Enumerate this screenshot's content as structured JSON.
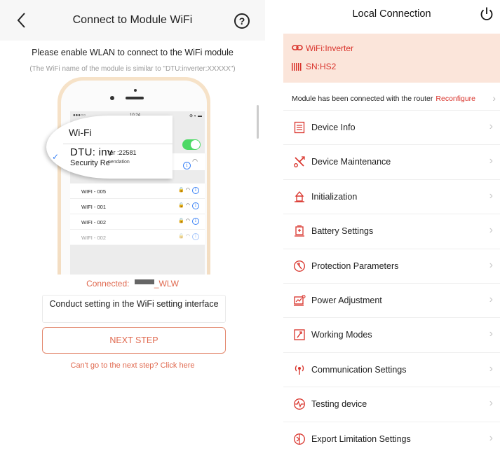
{
  "left": {
    "title": "Connect to Module WiFi",
    "back_icon": "chevron-left-icon",
    "help_label": "?",
    "instruction": "Please enable WLAN to connect to the WiFi module",
    "hint_note": "(The WiFi name of the module is similar to \"DTU:inverter:XXXXX\")",
    "phone": {
      "status_dots": "●●●○○",
      "status_time": "10:24",
      "status_icons": "⊕ ◐ ▬",
      "screen_title": "Wi-Fi",
      "magnifier_title": "Wi-Fi",
      "connected_name_big": "DTU: inv",
      "connected_name_small": "ter :22581",
      "security_big": "Security Re",
      "security_small": "nendation",
      "networks": [
        {
          "name": "WIFI - 005",
          "icons": "🔒 ◠"
        },
        {
          "name": "WIFI - 001",
          "icons": "🔒 ◠"
        },
        {
          "name": "WIFI - 002",
          "icons": "🔒 ◠"
        },
        {
          "name": "WIFI - 002",
          "icons": "🔒 ◠"
        }
      ]
    },
    "connected_label": "Connected:",
    "connected_suffix": "_WLW",
    "setting_hint": "Conduct setting in the WiFi setting interface",
    "next_button": "NEXT STEP",
    "cant_go": "Can't go to the next step? Click here"
  },
  "right": {
    "title": "Local Connection",
    "power_icon": "power-icon",
    "wifi_label": "WiFi:Inverter",
    "sn_label": "SN:HS2",
    "router_text": "Module has been connected with the router",
    "reconfigure": "Reconfigure",
    "menu": [
      {
        "label": "Device Info",
        "icon": "document-list-icon"
      },
      {
        "label": "Device Maintenance",
        "icon": "tools-icon"
      },
      {
        "label": "Initialization",
        "icon": "initialization-icon"
      },
      {
        "label": "Battery Settings",
        "icon": "battery-settings-icon"
      },
      {
        "label": "Protection Parameters",
        "icon": "protection-icon"
      },
      {
        "label": "Power Adjustment",
        "icon": "power-adjustment-icon"
      },
      {
        "label": "Working Modes",
        "icon": "working-modes-icon"
      },
      {
        "label": "Communication Settings",
        "icon": "communication-icon"
      },
      {
        "label": "Testing device",
        "icon": "testing-icon"
      },
      {
        "label": "Export Limitation Settings",
        "icon": "export-limitation-icon"
      }
    ]
  },
  "colors": {
    "accent": "#d9332b",
    "accent_soft": "#e0694f",
    "banner_bg": "#fbe5da",
    "toggle_on": "#4cd964",
    "info_blue": "#3b82f6"
  }
}
